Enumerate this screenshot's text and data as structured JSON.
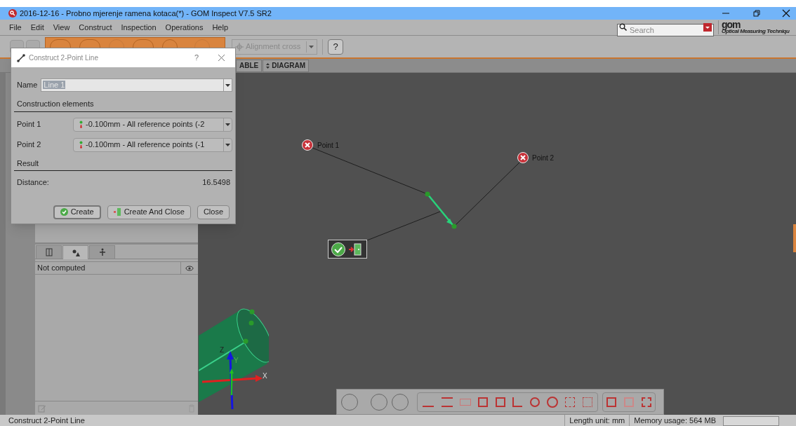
{
  "window": {
    "title": "2016-12-16 - Probno mjerenje ramena kotaca(*) - GOM Inspect V7.5 SR2"
  },
  "menu": [
    "File",
    "Edit",
    "View",
    "Construct",
    "Inspection",
    "Operations",
    "Help"
  ],
  "search": {
    "placeholder": "Search"
  },
  "logo": {
    "name": "gom",
    "tagline": "Optical Measuring Techniqu"
  },
  "toolbar": {
    "alignment": {
      "value": "Alignment cross",
      "disabled": true
    },
    "help": "?"
  },
  "view_tabs": [
    {
      "label": "ABLE",
      "kind": "plain"
    },
    {
      "label": "DIAGRAM",
      "kind": "sort"
    }
  ],
  "dialog": {
    "title": "Construct 2-Point Line",
    "help": "?",
    "name_label": "Name",
    "name_value": "Line 1",
    "section_elements": "Construction elements",
    "points": [
      {
        "label": "Point 1",
        "value": "-0.100mm - All reference points (-2"
      },
      {
        "label": "Point 2",
        "value": "-0.100mm - All reference points (-1"
      }
    ],
    "section_result": "Result",
    "distance_label": "Distance:",
    "distance_value": "16.5498",
    "buttons": [
      {
        "label": "Create",
        "kind": "check",
        "selected": true
      },
      {
        "label": "Create And Close",
        "kind": "exit",
        "selected": false
      },
      {
        "label": "Close",
        "kind": "plain",
        "selected": false
      }
    ]
  },
  "panel": {
    "tabs": [
      {
        "kind": "list",
        "selected": false
      },
      {
        "kind": "shapes",
        "selected": true
      },
      {
        "kind": "figure",
        "selected": false
      }
    ],
    "header": "Not computed"
  },
  "viewport": {
    "labels": [
      "Point 1",
      "Point 2"
    ],
    "axes": [
      "X",
      "Y",
      "Z"
    ]
  },
  "status_bar": {
    "message": "Construct 2-Point Line",
    "unit": "Length unit: mm",
    "memory": "Memory usage: 564 MB"
  }
}
